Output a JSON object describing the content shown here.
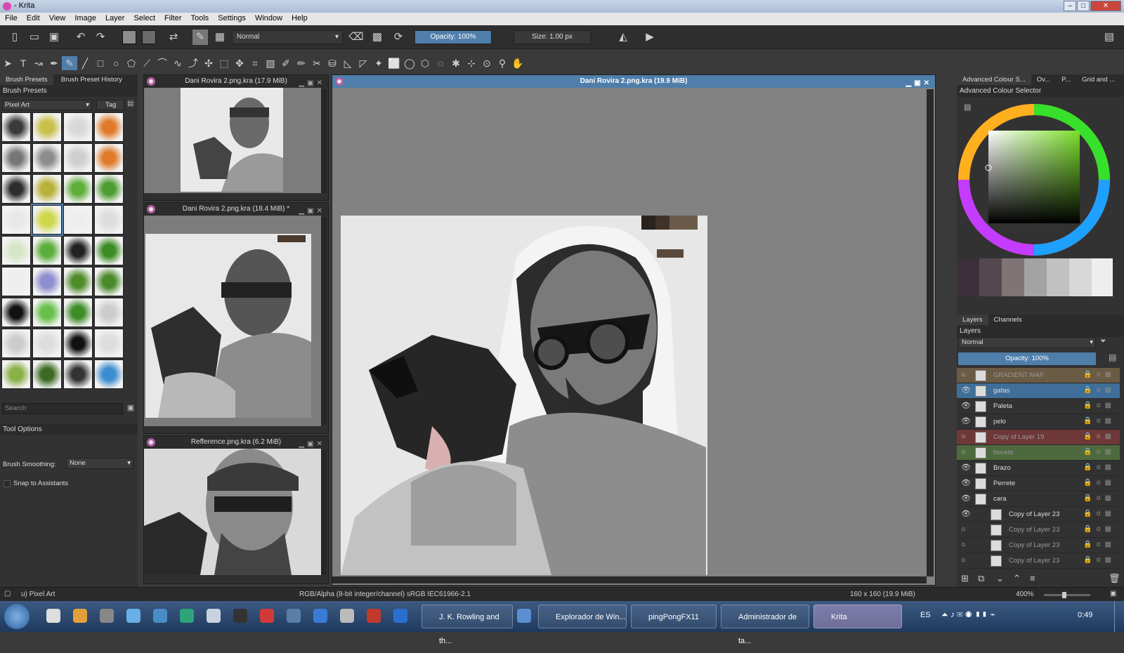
{
  "window": {
    "title": "- Krita"
  },
  "menu": [
    "File",
    "Edit",
    "View",
    "Image",
    "Layer",
    "Select",
    "Filter",
    "Tools",
    "Settings",
    "Window",
    "Help"
  ],
  "toolbar": {
    "blend_mode": "Normal",
    "opacity": "Opacity: 100%",
    "size": "Size: 1.00 px"
  },
  "left": {
    "tabs": [
      "Brush Presets",
      "Brush Preset History"
    ],
    "panel_title": "Brush Presets",
    "preset_filter": "Pixel Art",
    "tag_label": "Tag",
    "search_placeholder": "Search",
    "tool_options_title": "Tool Options",
    "brush_smoothing_label": "Brush Smoothing:",
    "brush_smoothing_value": "None",
    "snap_label": "Snap to Assistants"
  },
  "docs": [
    {
      "title": "Dani Rovira 2.png.kra (17.9 MiB)"
    },
    {
      "title": "Dani Rovira 2.png.kra (18.4 MiB) *"
    },
    {
      "title": "Refference.png.kra (6.2 MiB)"
    },
    {
      "title": "Dani Rovira 2.png.kra (19.9 MiB)"
    }
  ],
  "right": {
    "tabs": [
      "Advanced Colour S...",
      "Ov...",
      "P...",
      "Grid and ..."
    ],
    "color_panel_title": "Advanced Colour Selector",
    "layer_tabs": [
      "Layers",
      "Channels"
    ],
    "layers_title": "Layers",
    "layer_blend": "Normal",
    "layer_opacity": "Opacity:  100%",
    "layers": [
      {
        "name": "GRADIENT MAP",
        "color": "#6b5a44",
        "visible": false
      },
      {
        "name": "gafas",
        "color": "#3f6e98",
        "visible": true
      },
      {
        "name": "Paleta",
        "color": "#323232",
        "visible": true
      },
      {
        "name": "pelo",
        "color": "#323232",
        "visible": true
      },
      {
        "name": "Copy of Layer 19",
        "color": "#6e3838",
        "visible": false
      },
      {
        "name": "boceto",
        "color": "#4d6a3e",
        "visible": false
      },
      {
        "name": "Brazo",
        "color": "#323232",
        "visible": true
      },
      {
        "name": "Perrete",
        "color": "#323232",
        "visible": true
      },
      {
        "name": "cara",
        "color": "#323232",
        "visible": true
      },
      {
        "name": "Copy of Layer 23",
        "color": "#323232",
        "visible": true
      },
      {
        "name": "Copy of Layer 23",
        "color": "#323232",
        "visible": false
      },
      {
        "name": "Copy of Layer 23",
        "color": "#323232",
        "visible": false
      },
      {
        "name": "Copy of Layer 23",
        "color": "#323232",
        "visible": false
      }
    ]
  },
  "status": {
    "preset": "u) Pixel Art",
    "colorspace": "RGB/Alpha (8-bit integer/channel)  sRGB IEC61966-2.1",
    "dims": "160 x 160 (19.9 MiB)",
    "zoom": "400%"
  },
  "taskbar": {
    "items": [
      "J. K. Rowling and th...",
      "Explorador de Win...",
      "pingPongFX11",
      "Administrador de ta...",
      "Krita"
    ],
    "lang": "ES",
    "clock": "0:49"
  }
}
